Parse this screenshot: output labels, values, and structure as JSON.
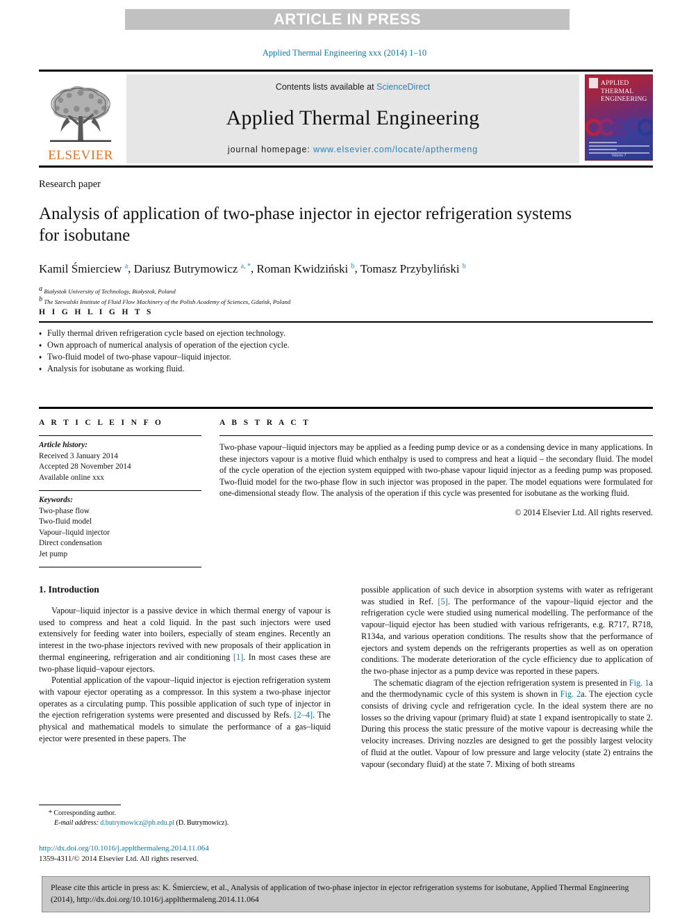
{
  "banner": {
    "text": "ARTICLE IN PRESS"
  },
  "running_head": "Applied Thermal Engineering xxx (2014) 1–10",
  "masthead": {
    "contents_prefix": "Contents lists available at ",
    "contents_link": "ScienceDirect",
    "journal_title": "Applied Thermal Engineering",
    "homepage_label": "journal homepage: ",
    "homepage_url": "www.elsevier.com/locate/apthermeng",
    "publisher_wordmark": "ELSEVIER",
    "cover_title": "APPLIED THERMAL ENGINEERING",
    "cover_bottom": "Volume 7"
  },
  "article": {
    "type": "Research paper",
    "title": "Analysis of application of two-phase injector in ejector refrigeration systems for isobutane",
    "authors": [
      {
        "name": "Kamil Śmierciew",
        "marks": "a"
      },
      {
        "name": "Dariusz Butrymowicz",
        "marks": "a, *"
      },
      {
        "name": "Roman Kwidziński",
        "marks": "b"
      },
      {
        "name": "Tomasz Przybyliński",
        "marks": "b"
      }
    ],
    "affiliations": [
      {
        "mark": "a",
        "text": "Białystok University of Technology, Białystok, Poland"
      },
      {
        "mark": "b",
        "text": "The Szewalski Institute of Fluid Flow Machinery of the Polish Academy of Sciences, Gdańsk, Poland"
      }
    ]
  },
  "highlights": {
    "label": "H I G H L I G H T S",
    "items": [
      "Fully thermal driven refrigeration cycle based on ejection technology.",
      "Own approach of numerical analysis of operation of the ejection cycle.",
      "Two-fluid model of two-phase vapour–liquid injector.",
      "Analysis for isobutane as working fluid."
    ]
  },
  "article_info": {
    "label": "A R T I C L E    I N F O",
    "history_label": "Article history:",
    "history": [
      "Received 3 January 2014",
      "Accepted 28 November 2014",
      "Available online xxx"
    ],
    "keywords_label": "Keywords:",
    "keywords": [
      "Two-phase flow",
      "Two-fluid model",
      "Vapour–liquid injector",
      "Direct condensation",
      "Jet pump"
    ]
  },
  "abstract": {
    "label": "A B S T R A C T",
    "text": "Two-phase vapour–liquid injectors may be applied as a feeding pump device or as a condensing device in many applications. In these injectors vapour is a motive fluid which enthalpy is used to compress and heat a liquid – the secondary fluid. The model of the cycle operation of the ejection system equipped with two-phase vapour liquid injector as a feeding pump was proposed. Two-fluid model for the two-phase flow in such injector was proposed in the paper. The model equations were formulated for one-dimensional steady flow. The analysis of the operation if this cycle was presented for isobutane as the working fluid.",
    "copyright": "© 2014 Elsevier Ltd. All rights reserved."
  },
  "body": {
    "section_number_title": "1.  Introduction",
    "left_paragraphs": [
      "Vapour–liquid injector is a passive device in which thermal energy of vapour is used to compress and heat a cold liquid. In the past such injectors were used extensively for feeding water into boilers, especially of steam engines. Recently an interest in the two-phase injectors revived with new proposals of their application in thermal engineering, refrigeration and air conditioning [1]. In most cases these are two-phase liquid–vapour ejectors.",
      "Potential application of the vapour–liquid injector is ejection refrigeration system with vapour ejector operating as a compressor. In this system a two-phase injector operates as a circulating pump. This possible application of such type of injector in the ejection refrigeration systems were presented and discussed by Refs. [2–4]. The physical and mathematical models to simulate the performance of a gas–liquid ejector were presented in these papers. The"
    ],
    "right_paragraphs": [
      "possible application of such device in absorption systems with water as refrigerant was studied in Ref. [5]. The performance of the vapour–liquid ejector and the refrigeration cycle were studied using numerical modelling. The performance of the vapour–liquid ejector has been studied with various refrigerants, e.g. R717, R718, R134a, and various operation conditions. The results show that the performance of ejectors and system depends on the refrigerants properties as well as on operation conditions. The moderate deterioration of the cycle efficiency due to application of the two-phase injector as a pump device was reported in these papers.",
      "The schematic diagram of the ejection refrigeration system is presented in Fig. 1a and the thermodynamic cycle of this system is shown in Fig. 2a. The ejection cycle consists of driving cycle and refrigeration cycle. In the ideal system there are no losses so the driving vapour (primary fluid) at state 1 expand isentropically to state 2. During this process the static pressure of the motive vapour is decreasing while the velocity increases. Driving nozzles are designed to get the possibly largest velocity of fluid at the outlet. Vapour of low pressure and large velocity (state 2) entrains the vapour (secondary fluid) at the state 7. Mixing of both streams"
    ],
    "inline_refs": [
      "[1]",
      "[2–4]",
      "[5]",
      "Fig. 1",
      "Fig. 2"
    ]
  },
  "footnotes": {
    "corresponding": "*  Corresponding author.",
    "email_label": "E-mail address:",
    "email": "d.butrymowicz@pb.edu.pl",
    "email_suffix": "(D. Butrymowicz).",
    "doi_url": "http://dx.doi.org/10.1016/j.applthermaleng.2014.11.064",
    "issn_line": "1359-4311/© 2014 Elsevier Ltd. All rights reserved."
  },
  "citation_box": {
    "text": "Please cite this article in press as: K. Śmierciew, et al., Analysis of application of two-phase injector in ejector refrigeration systems for isobutane, Applied Thermal Engineering (2014), http://dx.doi.org/10.1016/j.applthermaleng.2014.11.064"
  },
  "colors": {
    "link": "#0d76a8",
    "elsevier_orange": "#e8701a",
    "banner_gray": "#c1c1c1",
    "masthead_gray": "#e6e6e6",
    "cite_box_gray": "#c9c9c9"
  }
}
